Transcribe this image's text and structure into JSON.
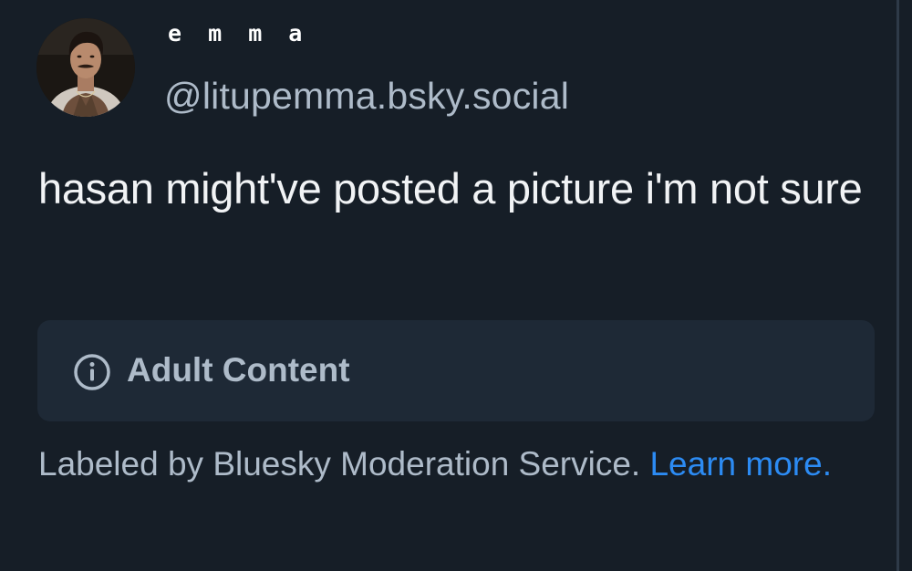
{
  "post": {
    "author": {
      "display_name": "e m m a",
      "handle": "@litupemma.bsky.social"
    },
    "text": "hasan might've posted a picture i'm not sure"
  },
  "content_label": {
    "icon": "info-circle-icon",
    "text": "Adult Content"
  },
  "moderation": {
    "text": "Labeled by Bluesky Moderation Service.",
    "link_label": "Learn more."
  },
  "colors": {
    "background": "#161e27",
    "label_box": "#1e2936",
    "muted_text": "#aebbc9",
    "link": "#2c8bf3"
  }
}
